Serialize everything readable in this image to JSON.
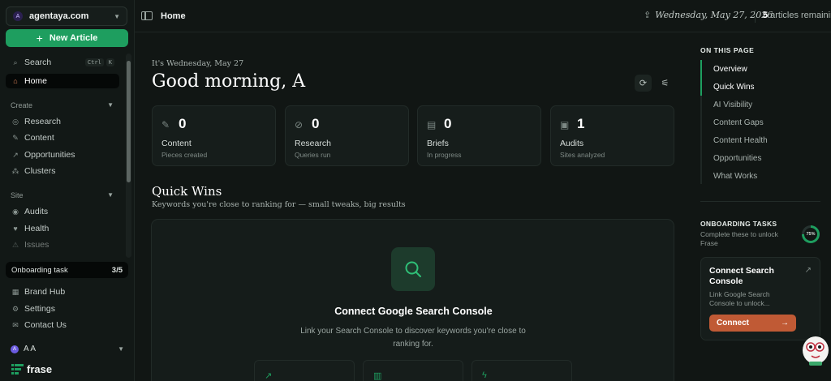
{
  "sidebar": {
    "site": {
      "logo": "A",
      "name": "agentaya.com"
    },
    "new_article_label": "New Article",
    "search": {
      "label": "Search",
      "shortcut_keys": [
        "Ctrl",
        "K"
      ]
    },
    "home_label": "Home",
    "create_section": {
      "label": "Create",
      "items": [
        {
          "label": "Research",
          "icon": "globe-icon"
        },
        {
          "label": "Content",
          "icon": "feather-icon"
        },
        {
          "label": "Opportunities",
          "icon": "trend-icon"
        },
        {
          "label": "Clusters",
          "icon": "cluster-icon"
        }
      ]
    },
    "site_section": {
      "label": "Site",
      "items": [
        {
          "label": "Audits",
          "icon": "audit-icon"
        },
        {
          "label": "Health",
          "icon": "heart-icon"
        },
        {
          "label": "Issues",
          "icon": "warning-icon"
        }
      ]
    },
    "onboarding": {
      "label": "Onboarding task",
      "count": "3/5"
    },
    "bottom_items": [
      {
        "label": "Brand Hub",
        "icon": "brand-icon"
      },
      {
        "label": "Settings",
        "icon": "gear-icon"
      },
      {
        "label": "Contact Us",
        "icon": "mail-icon"
      }
    ],
    "user": {
      "initial": "A",
      "name": "A A"
    },
    "brand_name": "frase"
  },
  "topbar": {
    "title": "Home",
    "date": "Wednesday, May 27, 2026",
    "articles_count": "5",
    "articles_label": "articles remaining"
  },
  "main": {
    "greeting_sub": "It's Wednesday, May 27",
    "greeting": "Good morning, A",
    "stats": [
      {
        "value": "0",
        "label": "Content",
        "sub": "Pieces created",
        "icon": "feather-icon"
      },
      {
        "value": "0",
        "label": "Research",
        "sub": "Queries run",
        "icon": "compass-icon"
      },
      {
        "value": "0",
        "label": "Briefs",
        "sub": "In progress",
        "icon": "document-icon"
      },
      {
        "value": "1",
        "label": "Audits",
        "sub": "Sites analyzed",
        "icon": "clipboard-icon"
      }
    ],
    "quick_wins": {
      "title": "Quick Wins",
      "subtitle": "Keywords you're close to ranking for — small tweaks, big results",
      "heading": "Connect Google Search Console",
      "description": "Link your Search Console to discover keywords you're close to ranking for."
    }
  },
  "right_panel": {
    "on_this_page_title": "ON THIS PAGE",
    "toc": [
      "Overview",
      "Quick Wins",
      "AI Visibility",
      "Content Gaps",
      "Content Health",
      "Opportunities",
      "What Works"
    ],
    "onboarding_title": "ONBOARDING TASKS",
    "onboarding_sub": "Complete these to unlock Frase",
    "progress_percent": 75,
    "progress_label": "75%",
    "card": {
      "title": "Connect Search Console",
      "description": "Link Google Search Console to unlock...",
      "button_label": "Connect"
    }
  },
  "colors": {
    "accent": "#1e9e5f",
    "cta": "#c05a35",
    "background": "#111614"
  }
}
